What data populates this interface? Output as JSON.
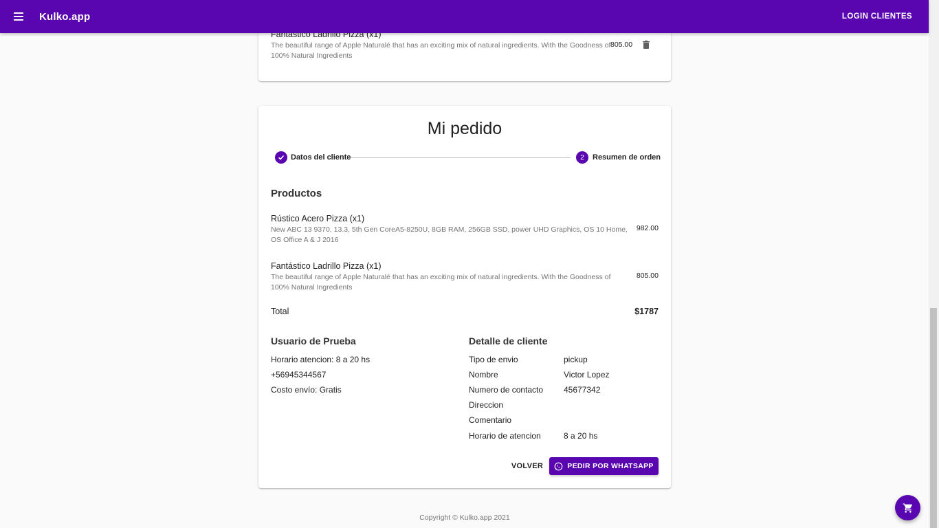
{
  "appbar": {
    "title": "Kulko.app",
    "login_label": "LOGIN CLIENTES",
    "menu_icon": "menu-icon"
  },
  "top_card": {
    "item": {
      "name": "Fantástico Ladrillo Pizza (x1)",
      "description": "The beautiful range of Apple Naturalé that has an exciting mix of natural ingredients. With the Goodness of 100% Natural Ingredients",
      "price": "805.00",
      "delete_icon": "trash-icon"
    }
  },
  "order": {
    "title": "Mi pedido",
    "steps": [
      {
        "label": "Datos del cliente",
        "state": "completed",
        "icon": "check-icon"
      },
      {
        "number": "2",
        "label": "Resumen de orden",
        "state": "active"
      }
    ],
    "products_heading": "Productos",
    "products": [
      {
        "name": "Rústico Acero Pizza (x1)",
        "description": "New ABC 13 9370, 13.3, 5th Gen CoreA5-8250U, 8GB RAM, 256GB SSD, power UHD Graphics, OS 10 Home, OS Office A & J 2016",
        "price": "982.00"
      },
      {
        "name": "Fantástico Ladrillo Pizza (x1)",
        "description": "The beautiful range of Apple Naturalé that has an exciting mix of natural ingredients. With the Goodness of 100% Natural Ingredients",
        "price": "805.00"
      }
    ],
    "total_label": "Total",
    "total_value": "$1787",
    "store": {
      "heading": "Usuario de Prueba",
      "lines": [
        "Horario atencion: 8 a 20 hs",
        "+56945344567",
        "Costo envío: Gratis"
      ]
    },
    "client": {
      "heading": "Detalle de cliente",
      "rows": [
        {
          "label": "Tipo de envio",
          "value": "pickup"
        },
        {
          "label": "Nombre",
          "value": "Victor Lopez"
        },
        {
          "label": "Numero de contacto",
          "value": "45677342"
        },
        {
          "label": "Direccion",
          "value": ""
        },
        {
          "label": "Comentario",
          "value": ""
        },
        {
          "label": "Horario de atencion",
          "value": "8 a 20 hs"
        }
      ]
    },
    "back_label": "VOLVER",
    "whatsapp_label": "PEDIR POR WHATSAPP",
    "whatsapp_icon": "whatsapp-icon"
  },
  "footer": {
    "text": "Copyright © Kulko.app 2021"
  },
  "fab": {
    "icon": "shopping-cart-icon"
  },
  "colors": {
    "primary": "#5a06b0",
    "background": "#fafafa",
    "card": "#ffffff"
  }
}
